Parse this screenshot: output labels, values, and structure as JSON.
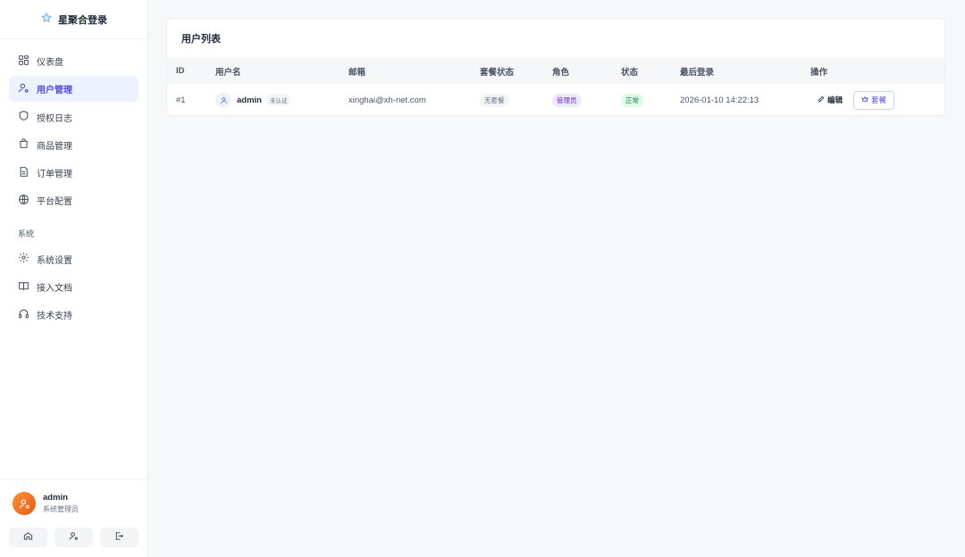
{
  "app": {
    "brand_title": "星聚合登录"
  },
  "sidebar": {
    "items": [
      {
        "label": "仪表盘",
        "icon": "dashboard-icon"
      },
      {
        "label": "用户管理",
        "icon": "users-icon",
        "active": true
      },
      {
        "label": "授权日志",
        "icon": "shield-icon"
      },
      {
        "label": "商品管理",
        "icon": "shopping-bag-icon"
      },
      {
        "label": "订单管理",
        "icon": "document-icon"
      },
      {
        "label": "平台配置",
        "icon": "globe-icon"
      }
    ],
    "section_label": "系统",
    "system_items": [
      {
        "label": "系统设置",
        "icon": "gear-icon"
      },
      {
        "label": "接入文档",
        "icon": "book-icon"
      },
      {
        "label": "技术支持",
        "icon": "headset-icon"
      }
    ],
    "user": {
      "name": "admin",
      "role": "系统管理员"
    }
  },
  "main": {
    "card_title": "用户列表",
    "columns": [
      "ID",
      "用户名",
      "邮箱",
      "套餐状态",
      "角色",
      "状态",
      "最后登录",
      "操作"
    ],
    "rows": [
      {
        "id": "#1",
        "username": "admin",
        "verify_tag": "未认证",
        "email": "xinghai@xh-net.com",
        "plan_status": "无套餐",
        "role": "管理员",
        "status": "正常",
        "last_login": "2026-01-10 14:22:13",
        "edit_label": "编辑",
        "plan_label": "套餐"
      }
    ]
  },
  "colors": {
    "accent": "#4f46e5",
    "active_bg": "#eef2ff",
    "avatar": "#f97316",
    "ok": "#15803d"
  }
}
